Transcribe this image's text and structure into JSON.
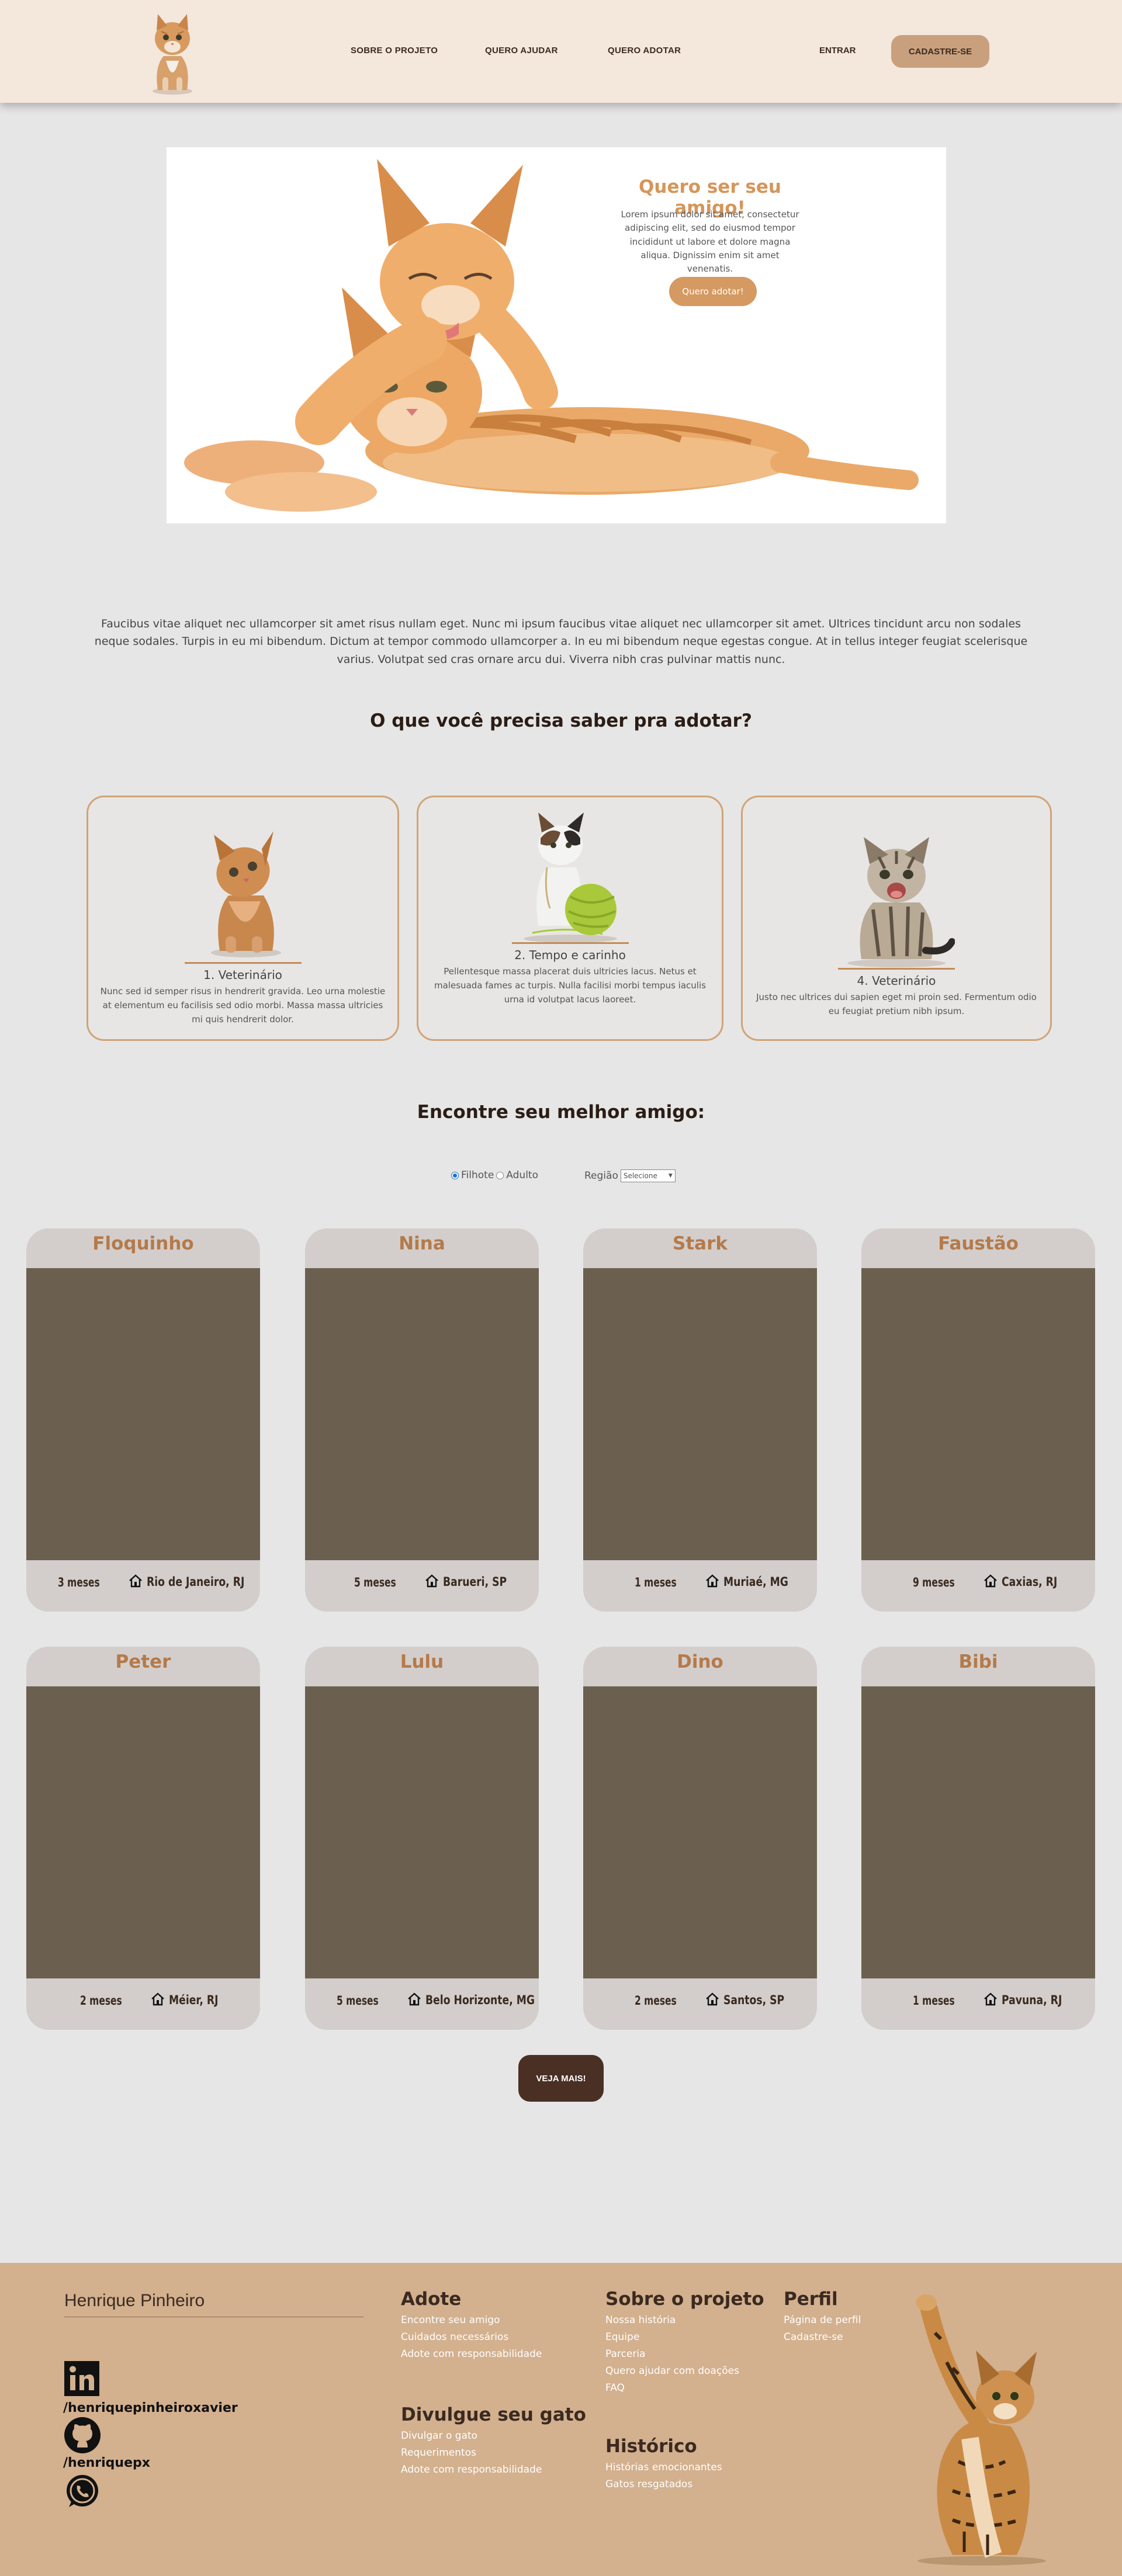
{
  "nav": {
    "links": [
      "SOBRE O PROJETO",
      "QUERO AJUDAR",
      "QUERO ADOTAR"
    ],
    "login": "ENTRAR",
    "signup": "CADASTRE-SE"
  },
  "hero": {
    "title": "Quero ser seu amigo!",
    "text": "Lorem ipsum dolor sit amet, consectetur adipiscing elit, sed do eiusmod tempor incididunt ut labore et dolore magna aliqua. Dignissim enim sit amet venenatis.",
    "button": "Quero adotar!"
  },
  "intro": "Faucibus vitae aliquet nec ullamcorper sit amet risus nullam eget. Nunc mi ipsum faucibus vitae aliquet nec ullamcorper sit amet. Ultrices tincidunt arcu non sodales neque sodales. Turpis in eu mi bibendum. Dictum at tempor commodo ullamcorper a. In eu mi bibendum neque egestas congue. At in tellus integer feugiat scelerisque varius. Volutpat sed cras ornare arcu dui. Viverra nibh cras pulvinar mattis nunc.",
  "adopt_section": {
    "title": "O que você precisa saber pra adotar?",
    "cards": [
      {
        "title": "1. Veterinário",
        "text": "Nunc sed id semper risus in hendrerit gravida. Leo urna molestie at elementum eu facilisis sed odio morbi. Massa massa ultricies mi quis hendrerit dolor."
      },
      {
        "title": "2. Tempo e carinho",
        "text": "Pellentesque massa placerat duis ultricies lacus. Netus et malesuada fames ac turpis. Nulla facilisi morbi tempus iaculis urna id volutpat lacus laoreet."
      },
      {
        "title": "4. Veterinário",
        "text": "Justo nec ultrices dui sapien eget mi proin sed. Fermentum odio eu feugiat pretium nibh ipsum."
      }
    ]
  },
  "find_section": {
    "title": "Encontre seu melhor amigo:",
    "filter": {
      "puppy": "Filhote",
      "adult": "Adulto",
      "region_label": "Região",
      "region_value": "Selecione"
    }
  },
  "pets": [
    {
      "name": "Floquinho",
      "age": "3 meses",
      "location": "Rio de Janeiro, RJ"
    },
    {
      "name": "Nina",
      "age": "5 meses",
      "location": "Barueri, SP"
    },
    {
      "name": "Stark",
      "age": "1 meses",
      "location": "Muriaé, MG"
    },
    {
      "name": "Faustão",
      "age": "9 meses",
      "location": "Caxias, RJ"
    },
    {
      "name": "Peter",
      "age": "2 meses",
      "location": "Méier, RJ"
    },
    {
      "name": "Lulu",
      "age": "5 meses",
      "location": "Belo Horizonte, MG"
    },
    {
      "name": "Dino",
      "age": "2 meses",
      "location": "Santos, SP"
    },
    {
      "name": "Bibi",
      "age": "1 meses",
      "location": "Pavuna, RJ"
    }
  ],
  "more_button": "VEJA MAIS!",
  "footer": {
    "name": "Henrique Pinheiro",
    "social": [
      "/henriquepinheiroxavier",
      "/henriquepx"
    ],
    "adote": {
      "title": "Adote",
      "links": [
        "Encontre seu amigo",
        "Cuidados necessários",
        "Adote com responsabilidade"
      ]
    },
    "divulgue": {
      "title": "Divulgue seu gato",
      "links": [
        "Divulgar o gato",
        "Requerimentos",
        "Adote com responsabilidade"
      ]
    },
    "sobre": {
      "title": "Sobre o projeto",
      "links": [
        "Nossa história",
        "Equipe",
        "Parceria",
        "Quero ajudar com doações",
        "FAQ"
      ]
    },
    "historico": {
      "title": "Histórico",
      "links": [
        "Histórias emocionantes",
        "Gatos resgatados"
      ]
    },
    "perfil": {
      "title": "Perfil",
      "links": [
        "Página de perfil",
        "Cadastre-se"
      ]
    }
  }
}
